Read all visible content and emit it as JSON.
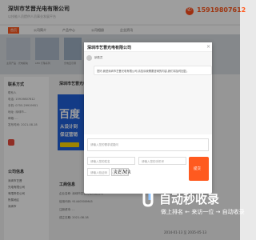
{
  "header": {
    "company_name": "深圳市艺晋光电有限公司",
    "subtitle": "以技能人员提供人员事业发展平台",
    "phone": "15919807612"
  },
  "nav": {
    "items": [
      "首页",
      "公司简介",
      "产品中心",
      "公司相册",
      "企业资讯"
    ]
  },
  "banner": {
    "captions": [
      "主营产品 · 光电模块",
      "LED 灯珠系列",
      "光电显示屏",
      "工业光源"
    ]
  },
  "left": {
    "contact_title": "联系方式",
    "lines": [
      "联系人",
      "电话: 15919807612",
      "手机: 0755-29919951",
      "地址: 深圳市...",
      "邮箱: ...",
      "发布时间: 2021-08-18"
    ],
    "company_title": "公司信息",
    "company_list": [
      "深圳市艺晋",
      "光电有限公司",
      "有限责任公司",
      "所属地区",
      "深圳市"
    ]
  },
  "main": {
    "section_title": "深圳市艺晋光电有限公司",
    "ad": {
      "big_text": "百度",
      "line1": "从设计到",
      "line2": "保证营销"
    },
    "business_title": "工商信息",
    "business_rows": [
      "企业名称: 深圳市艺晋光电有限公司",
      "信用代码: 91440300MA5",
      "注册资本: ...",
      "成立日期: 2021-08-18"
    ]
  },
  "bottom_date": "2014-01-13 至 2035-05-13",
  "modal": {
    "title": "深圳市艺晋光电有限公司",
    "close_label": "×",
    "agent_name": "销售员",
    "message": "您好,我是深圳市艺晋光电有限公司,请告诉我需要咨询的内容,我们将及时回复。",
    "message_placeholder": "请输入您的需求或疑问",
    "name_placeholder": "请输入您的姓名",
    "phone_placeholder": "请输入您的手机号",
    "captcha_placeholder": "请输入验证码",
    "captcha_text": "kEMk",
    "submit_label": "提交"
  },
  "watermark": {
    "main": "自动秒收录",
    "sub": "做上排名 ← 来访一位 → 自动收录"
  }
}
